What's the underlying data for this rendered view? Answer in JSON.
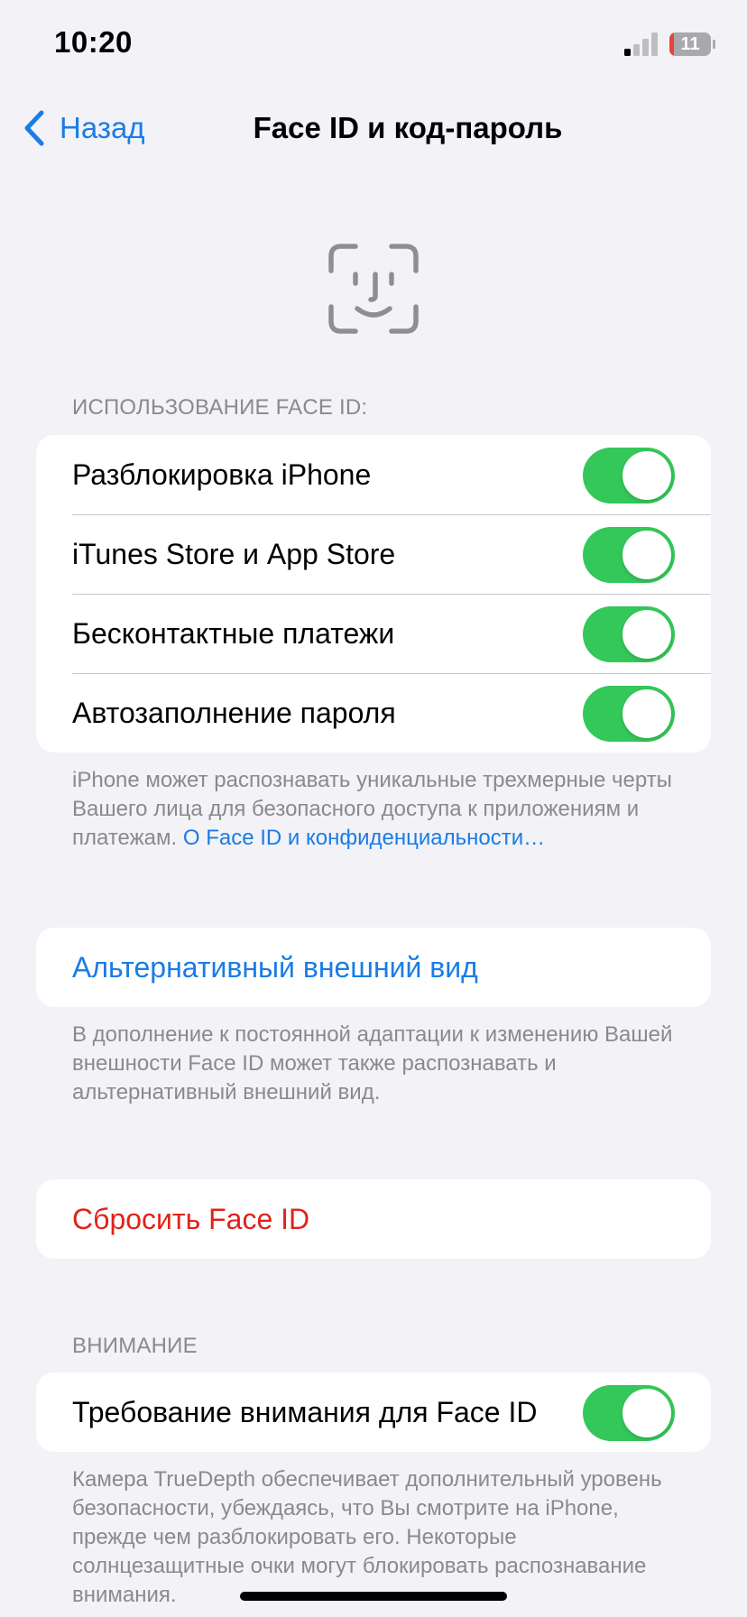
{
  "status_bar": {
    "time": "10:20",
    "battery_percent": 11,
    "battery_label": "11",
    "battery_color": "#E8443A",
    "signal_bars_active": 1,
    "signal_bars_total": 4
  },
  "nav": {
    "back_icon": "chevron-left-icon",
    "back_label": "Назад",
    "title": "Face ID и код-пароль"
  },
  "hero_icon": "face-id-icon",
  "usage_section": {
    "header": "ИСПОЛЬЗОВАНИЕ FACE ID:",
    "rows": [
      {
        "label": "Разблокировка iPhone",
        "on": true
      },
      {
        "label": "iTunes Store и App Store",
        "on": true
      },
      {
        "label": "Бесконтактные платежи",
        "on": true
      },
      {
        "label": "Автозаполнение пароля",
        "on": true
      }
    ],
    "footer_text": "iPhone может распознавать уникальные трехмерные черты Вашего лица для безопасного доступа к приложениям и платежам. ",
    "footer_link": "О Face ID и конфиденциальности…"
  },
  "alternate": {
    "label": "Альтернативный внешний вид",
    "footer": "В дополнение к постоянной адаптации к изменению Вашей внешности Face ID может также распознавать и альтернативный внешний вид."
  },
  "reset": {
    "label": "Сбросить Face ID"
  },
  "attention": {
    "header": "ВНИМАНИЕ",
    "row_label": "Требование внимания для Face ID",
    "on": true,
    "footer": "Камера TrueDepth обеспечивает дополнительный уровень безопасности, убеждаясь, что Вы смотрите на iPhone, прежде чем разблокировать его. Некоторые солнцезащитные очки могут блокировать распознавание внимания."
  },
  "colors": {
    "accent": "#1A7CE6",
    "toggle_on": "#34C759",
    "destructive": "#E0231B",
    "background": "#F2F2F7"
  }
}
